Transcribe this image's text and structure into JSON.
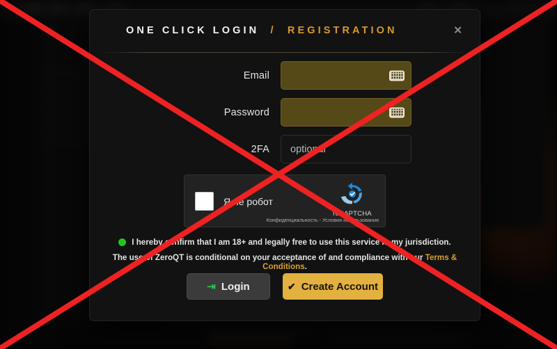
{
  "modal": {
    "title_main": "ONE CLICK LOGIN",
    "title_slash": "/",
    "title_reg": "REGISTRATION",
    "close_label": "✕"
  },
  "form": {
    "fields": [
      {
        "label": "Email",
        "value": "",
        "placeholder": "",
        "state": "autofilled",
        "icon": "keyboard-icon"
      },
      {
        "label": "Password",
        "value": "",
        "placeholder": "",
        "state": "autofilled",
        "icon": "keyboard-icon"
      },
      {
        "label": "2FA",
        "value": "",
        "placeholder": "optional",
        "state": "plain",
        "icon": ""
      }
    ]
  },
  "recaptcha": {
    "checkbox_label": "Я не робот",
    "brand": "reCAPTCHA",
    "terms": "Конфиденциальность - Условия использования",
    "checked": false
  },
  "consent": {
    "line1": "I hereby confirm that I am 18+ and legally free to use this service in my jurisdiction.",
    "line2_before": "The use of ZeroQT is conditional on your acceptance of and compliance with our ",
    "line2_link": "Terms & Conditions",
    "line2_after": "."
  },
  "buttons": {
    "login_icon": "⇥",
    "login_label": "Login",
    "create_icon": "✔",
    "create_label": "Create Account"
  },
  "annotation": {
    "type": "red-x-overlay",
    "color": "#ee2222"
  },
  "colors": {
    "accent_gold": "#e3b13f",
    "autofill_olive": "#554917",
    "green": "#22c51e",
    "modal_bg": "#121212",
    "annotation_red": "#ee2222"
  }
}
